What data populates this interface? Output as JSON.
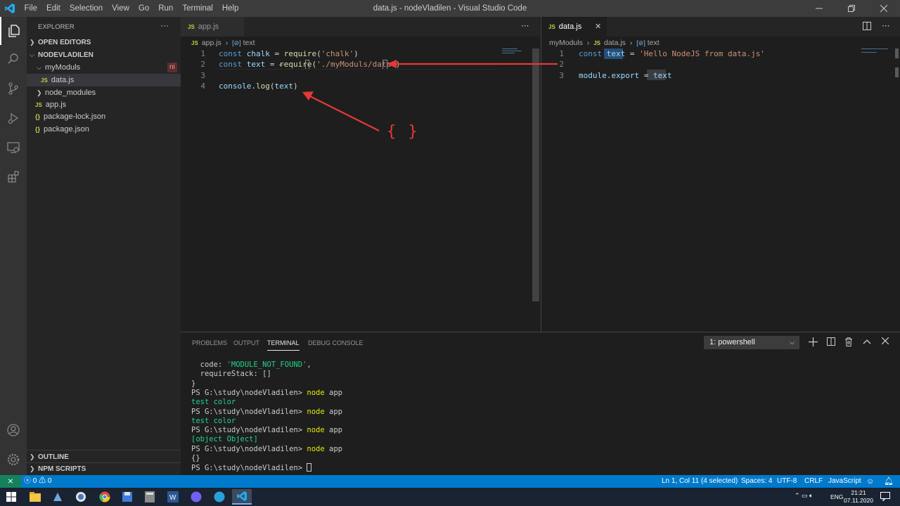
{
  "window": {
    "title": "data.js - nodeVladilen - Visual Studio Code",
    "menu": [
      "File",
      "Edit",
      "Selection",
      "View",
      "Go",
      "Run",
      "Terminal",
      "Help"
    ]
  },
  "sidebar": {
    "explorer_title": "EXPLORER",
    "more": "···",
    "open_editors": "OPEN EDITORS",
    "project": "NODEVLADILEN",
    "tree": [
      {
        "label": "myModuls",
        "kind": "folder",
        "badge": "ni"
      },
      {
        "label": "data.js",
        "kind": "js"
      },
      {
        "label": "node_modules",
        "kind": "folder"
      },
      {
        "label": "app.js",
        "kind": "js"
      },
      {
        "label": "package-lock.json",
        "kind": "json"
      },
      {
        "label": "package.json",
        "kind": "json"
      }
    ],
    "outline": "OUTLINE",
    "npm_scripts": "NPM SCRIPTS"
  },
  "editor_left": {
    "tab": "app.js",
    "breadcrumb": [
      "app.js",
      "text"
    ],
    "more": "···",
    "line_numbers": [
      "1",
      "2",
      "3",
      "4"
    ],
    "lines": [
      [
        [
          "kw",
          "const"
        ],
        [
          "pl",
          " "
        ],
        [
          "vr",
          "chalk"
        ],
        [
          "pl",
          " = "
        ],
        [
          "fn",
          "require"
        ],
        [
          "pl",
          "("
        ],
        [
          "st",
          "'chalk'"
        ],
        [
          "pl",
          ")"
        ]
      ],
      [
        [
          "kw",
          "const"
        ],
        [
          "pl",
          " "
        ],
        [
          "vr",
          "text"
        ],
        [
          "pl",
          " = "
        ],
        [
          "fn",
          "require"
        ],
        [
          "pl",
          "("
        ],
        [
          "st",
          "'./myModuls/data'"
        ],
        [
          "pl",
          ")"
        ]
      ],
      [],
      [
        [
          "vr",
          "console"
        ],
        [
          "pl",
          "."
        ],
        [
          "fn",
          "log"
        ],
        [
          "pl",
          "("
        ],
        [
          "vr",
          "text"
        ],
        [
          "pl",
          ")"
        ]
      ]
    ],
    "annotation": "{ }"
  },
  "editor_right": {
    "tab": "data.js",
    "close": "✕",
    "breadcrumb": [
      "myModuls",
      "data.js",
      "text"
    ],
    "more": "···",
    "line_numbers": [
      "1",
      "2",
      "3"
    ],
    "lines": [
      [
        [
          "kw",
          "const"
        ],
        [
          "pl",
          " "
        ],
        [
          "vr",
          "text"
        ],
        [
          "pl",
          " = "
        ],
        [
          "st",
          "'Hello NodeJS from data.js'"
        ]
      ],
      [],
      [
        [
          "vr",
          "module"
        ],
        [
          "pl",
          "."
        ],
        [
          "vr",
          "export"
        ],
        [
          "pl",
          " = "
        ],
        [
          "vr",
          "text"
        ]
      ]
    ]
  },
  "panel": {
    "tabs": [
      "PROBLEMS",
      "OUTPUT",
      "TERMINAL",
      "DEBUG CONSOLE"
    ],
    "active_tab": "TERMINAL",
    "shell_select": "1: powershell",
    "terminal": [
      [
        [
          "p",
          "  code: "
        ],
        [
          "s",
          "'MODULE_NOT_FOUND'"
        ],
        [
          "p",
          ","
        ]
      ],
      [
        [
          "p",
          "  requireStack: []"
        ]
      ],
      [
        [
          "p",
          "}"
        ]
      ],
      [
        [
          "p",
          "PS G:\\study\\nodeVladilen> "
        ],
        [
          "c",
          "node"
        ],
        [
          "p",
          " app"
        ]
      ],
      [
        [
          "g",
          "test color"
        ]
      ],
      [
        [
          "p",
          "PS G:\\study\\nodeVladilen> "
        ],
        [
          "c",
          "node"
        ],
        [
          "p",
          " app"
        ]
      ],
      [
        [
          "g",
          "test color"
        ]
      ],
      [
        [
          "p",
          "PS G:\\study\\nodeVladilen> "
        ],
        [
          "c",
          "node"
        ],
        [
          "p",
          " app"
        ]
      ],
      [
        [
          "g",
          "[object Object]"
        ]
      ],
      [
        [
          "p",
          "PS G:\\study\\nodeVladilen> "
        ],
        [
          "c",
          "node"
        ],
        [
          "p",
          " app"
        ]
      ],
      [
        [
          "p",
          "{}"
        ]
      ],
      [
        [
          "p",
          "PS G:\\study\\nodeVladilen> "
        ]
      ]
    ]
  },
  "statusbar": {
    "remote": "⨯",
    "errors": "0",
    "warnings": "0",
    "position": "Ln 1, Col 11 (4 selected)",
    "spaces": "Spaces: 4",
    "encoding": "UTF-8",
    "eol": "CRLF",
    "language": "JavaScript"
  },
  "taskbar": {
    "lang": "ENG",
    "time": "21:21",
    "date": "07.11.2020"
  }
}
